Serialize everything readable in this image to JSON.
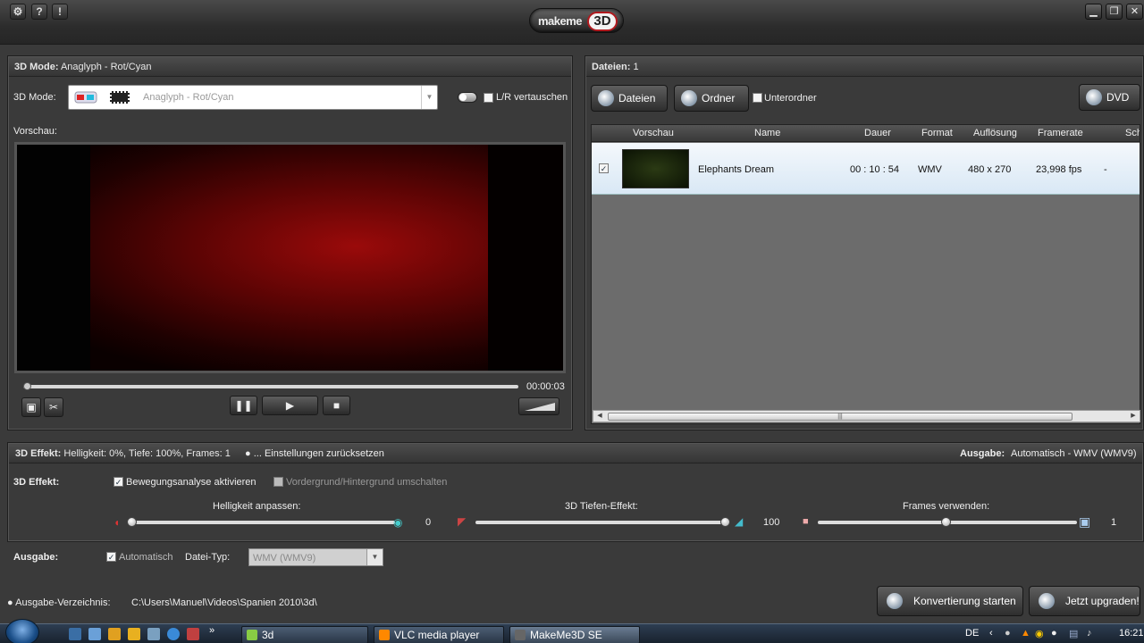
{
  "titlebar": {
    "icons": [
      "gear-icon",
      "help-icon",
      "info-icon"
    ],
    "help": "?",
    "info": "!",
    "logo_text": "makeme",
    "logo_badge": "3D"
  },
  "left_panel": {
    "header_label": "3D Mode:",
    "header_value": "Anaglyph - Rot/Cyan",
    "mode_label": "3D Mode:",
    "mode_value": "Anaglyph - Rot/Cyan",
    "swap_label": "L/R vertauschen",
    "preview_label": "Vorschau:",
    "time": "00:00:03"
  },
  "right_panel": {
    "header_label": "Dateien:",
    "header_count": "1",
    "btn_files": "Dateien",
    "btn_folder": "Ordner",
    "subfolder_label": "Unterordner",
    "btn_dvd": "DVD",
    "columns": [
      "Vorschau",
      "Name",
      "Dauer",
      "Format",
      "Auflösung",
      "Framerate",
      "Sch"
    ],
    "rows": [
      {
        "checked": true,
        "name": "Elephants Dream",
        "duration": "00 : 10 : 54",
        "format": "WMV",
        "resolution": "480 x 270",
        "framerate": "23,998 fps",
        "extra": "-"
      }
    ]
  },
  "effect_bar": {
    "label": "3D Effekt:",
    "summary": "Helligkeit: 0%, Tiefe: 100%, Frames: 1",
    "reset": "... Einstellungen zurücksetzen",
    "output_label": "Ausgabe:",
    "output_value": "Automatisch - WMV (WMV9)"
  },
  "effect": {
    "label": "3D Effekt:",
    "motion_label": "Bewegungsanalyse aktivieren",
    "motion_checked": true,
    "fg_label": "Vordergrund/Hintergrund umschalten",
    "fg_checked": false,
    "brightness_label": "Helligkeit anpassen:",
    "brightness_value": "0",
    "depth_label": "3D Tiefen-Effekt:",
    "depth_value": "100",
    "frames_label": "Frames verwenden:",
    "frames_value": "1"
  },
  "output": {
    "label": "Ausgabe:",
    "auto_label": "Automatisch",
    "auto_checked": true,
    "filetype_label": "Datei-Typ:",
    "filetype_value": "WMV (WMV9)"
  },
  "footer": {
    "dir_label": "Ausgabe-Verzeichnis:",
    "dir_value": "C:\\Users\\Manuel\\Videos\\Spanien 2010\\3d\\",
    "btn_convert": "Konvertierung starten",
    "btn_upgrade": "Jetzt upgraden!"
  },
  "taskbar": {
    "tasks": [
      "3d",
      "VLC media player",
      "MakeMe3D SE"
    ],
    "lang": "DE",
    "clock": "16:21"
  },
  "colors": {
    "accent_red": "#b0191e",
    "row_highlight": "#d9e8f5"
  }
}
